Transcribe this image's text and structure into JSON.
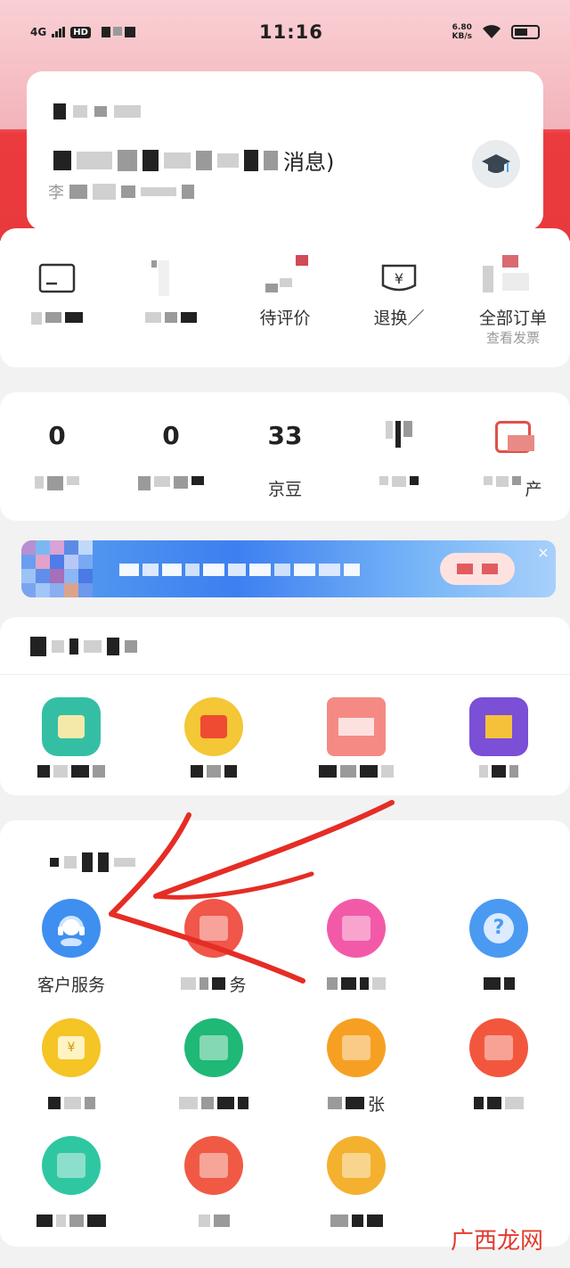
{
  "status_bar": {
    "network": "4G",
    "hd_badge": "HD",
    "time": "11:16",
    "speed": "6.80",
    "speed_unit": "KB/s"
  },
  "profile": {
    "title_suffix": "消息)",
    "name_prefix": "李"
  },
  "orders": {
    "items": [
      {
        "label": "",
        "icon": "payment-card-icon"
      },
      {
        "label": "",
        "icon": "box-icon"
      },
      {
        "label": "待评价",
        "icon": "comment-icon"
      },
      {
        "label": "退换／",
        "icon": "refund-icon"
      },
      {
        "label": "全部订单",
        "sub": "查看发票",
        "icon": "order-list-icon"
      }
    ]
  },
  "assets": {
    "items": [
      {
        "value": "0",
        "label": ""
      },
      {
        "value": "0",
        "label": ""
      },
      {
        "value": "33",
        "label": "京豆"
      },
      {
        "value": "",
        "label": ""
      },
      {
        "value": "",
        "label": "产",
        "icon": "wallet-icon"
      }
    ]
  },
  "services": {
    "items": [
      {
        "label": "客户服务",
        "icon": "headset-icon",
        "color": "#3f8ff0"
      },
      {
        "label": "务",
        "icon": "service-icon",
        "color": "#f0564a"
      },
      {
        "label": "",
        "icon": "gift-icon",
        "color": "#f25aa8"
      },
      {
        "label": "",
        "icon": "help-icon",
        "color": "#4a9af2"
      },
      {
        "label": "",
        "icon": "coin-icon",
        "color": "#f5c425"
      },
      {
        "label": "",
        "icon": "leaf-icon",
        "color": "#1fb876"
      },
      {
        "label": "张",
        "icon": "ticket-icon",
        "color": "#f6a023"
      },
      {
        "label": "",
        "icon": "store-icon",
        "color": "#f2573e"
      },
      {
        "label": "",
        "icon": "shirt-icon",
        "color": "#2fc7a1"
      },
      {
        "label": "",
        "icon": "person-icon",
        "color": "#f05a45"
      },
      {
        "label": "",
        "icon": "bag-icon",
        "color": "#f4b12f"
      }
    ]
  },
  "watermark": "广西龙网"
}
